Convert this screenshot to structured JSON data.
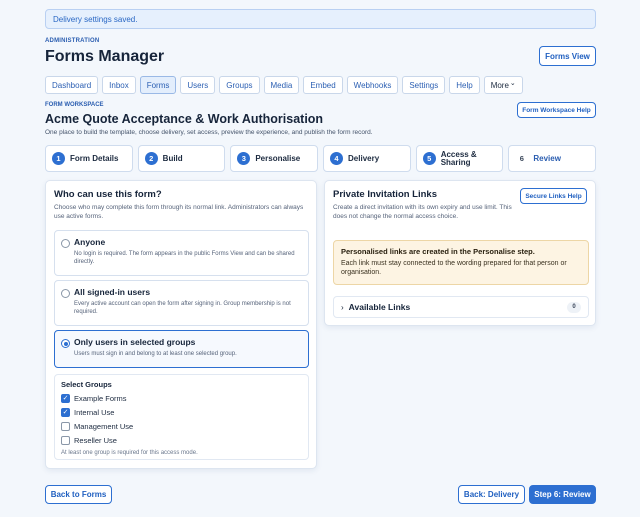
{
  "alert": {
    "text": "Delivery settings saved."
  },
  "header": {
    "eyebrow": "ADMINISTRATION",
    "title": "Forms Manager",
    "forms_view_label": "Forms View"
  },
  "nav": {
    "tabs": [
      {
        "label": "Dashboard"
      },
      {
        "label": "Inbox"
      },
      {
        "label": "Forms",
        "active": true
      },
      {
        "label": "Users"
      },
      {
        "label": "Groups"
      },
      {
        "label": "Media"
      },
      {
        "label": "Embed"
      },
      {
        "label": "Webhooks"
      },
      {
        "label": "Settings"
      },
      {
        "label": "Help"
      }
    ],
    "more_label": "More",
    "more_chevron": "⌄"
  },
  "workspace": {
    "eyebrow": "FORM WORKSPACE",
    "title": "Acme Quote Acceptance & Work Authorisation",
    "subtitle": "One place to build the template, choose delivery, set access, preview the experience, and publish the form record.",
    "help_label": "Form Workspace Help"
  },
  "steps": [
    {
      "num": "1",
      "label": "Form Details"
    },
    {
      "num": "2",
      "label": "Build"
    },
    {
      "num": "3",
      "label": "Personalise"
    },
    {
      "num": "4",
      "label": "Delivery"
    },
    {
      "num": "5",
      "label": "Access & Sharing"
    },
    {
      "num": "6",
      "label": "Review"
    }
  ],
  "access": {
    "title": "Who can use this form?",
    "description": "Choose who may complete this form through its normal link. Administrators can always use active forms.",
    "options": [
      {
        "title": "Anyone",
        "desc": "No login is required. The form appears in the public Forms View and can be shared directly.",
        "selected": false
      },
      {
        "title": "All signed-in users",
        "desc": "Every active account can open the form after signing in. Group membership is not required.",
        "selected": false
      },
      {
        "title": "Only users in selected groups",
        "desc": "Users must sign in and belong to at least one selected group.",
        "selected": true
      }
    ],
    "groups": {
      "title": "Select Groups",
      "items": [
        {
          "label": "Example Forms",
          "checked": true
        },
        {
          "label": "Internal Use",
          "checked": true
        },
        {
          "label": "Management Use",
          "checked": false
        },
        {
          "label": "Reseller Use",
          "checked": false
        }
      ],
      "hint": "At least one group is required for this access mode."
    }
  },
  "invites": {
    "title": "Private Invitation Links",
    "description": "Create a direct invitation with its own expiry and use limit. This does not change the normal access choice.",
    "help_label": "Secure Links Help",
    "notice_title": "Personalised links are created in the Personalise step.",
    "notice_body": "Each link must stay connected to the wording prepared for that person or organisation.",
    "links_label": "Available Links",
    "links_count": "0",
    "chevron": "›"
  },
  "footer": {
    "back_forms": "Back to Forms",
    "back_delivery": "Back: Delivery",
    "next": "Step 6: Review"
  },
  "colors": {
    "accent": "#2d6fd1",
    "notice_bg": "#fdf4e3",
    "page_bg": "#f3f7fc"
  }
}
